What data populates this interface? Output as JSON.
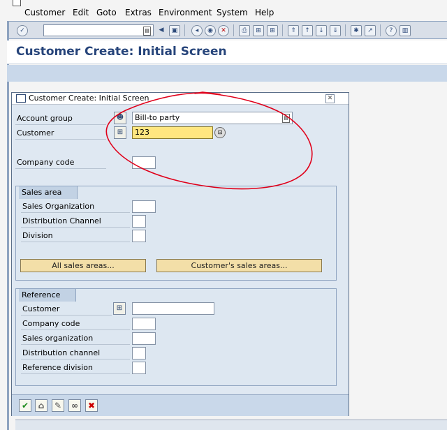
{
  "menu": {
    "items": [
      {
        "label": "Customer",
        "underline": "C"
      },
      {
        "label": "Edit",
        "underline": "E"
      },
      {
        "label": "Goto",
        "underline": "G"
      },
      {
        "label": "Extras",
        "underline": "x"
      },
      {
        "label": "Environment",
        "underline": "v"
      },
      {
        "label": "System",
        "underline": "S"
      },
      {
        "label": "Help",
        "underline": "H"
      }
    ]
  },
  "toolbar": {
    "command_field_value": "",
    "icons": [
      "enter-icon",
      "back-icon",
      "save-icon",
      "exit-icon",
      "cancel-icon",
      "print-icon",
      "find-icon",
      "find-next-icon",
      "first-page-icon",
      "prev-page-icon",
      "next-page-icon",
      "last-page-icon",
      "new-session-icon",
      "shortcut-icon",
      "help-icon",
      "layout-menu-icon"
    ]
  },
  "page": {
    "title": "Customer Create: Initial Screen"
  },
  "dialog": {
    "title": "Customer Create: Initial Screen",
    "account_group_label": "Account group",
    "account_group_value": "Bill-to party",
    "customer_label": "Customer",
    "customer_value": "123",
    "company_code_label": "Company code",
    "company_code_value": "",
    "sales_area": {
      "title": "Sales area",
      "sales_org_label": "Sales Organization",
      "distribution_channel_label": "Distribution Channel",
      "division_label": "Division",
      "all_sales_areas_button": "All sales areas...",
      "customers_sales_areas_button": "Customer's sales areas..."
    },
    "reference": {
      "title": "Reference",
      "customer_label": "Customer",
      "company_code_label": "Company code",
      "sales_org_label": "Sales organization",
      "distribution_channel_label": "Distribution channel",
      "division_label": "Reference division"
    }
  },
  "colors": {
    "title_blue": "#26447a",
    "annotation_red": "#e0001a",
    "active_field_yellow": "#ffe680"
  }
}
